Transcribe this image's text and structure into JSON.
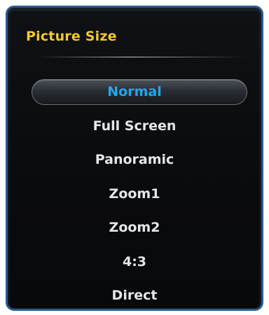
{
  "menu": {
    "title": "Picture Size",
    "options": [
      {
        "label": "Normal",
        "selected": true
      },
      {
        "label": "Full Screen",
        "selected": false
      },
      {
        "label": "Panoramic",
        "selected": false
      },
      {
        "label": "Zoom1",
        "selected": false
      },
      {
        "label": "Zoom2",
        "selected": false
      },
      {
        "label": "4:3",
        "selected": false
      },
      {
        "label": "Direct",
        "selected": false
      }
    ]
  },
  "colors": {
    "title": "#f2c930",
    "selected_text": "#21a8ef",
    "option_text": "#e6e6e6",
    "border": "#2e5a8a",
    "background": "#0a0b0d"
  }
}
